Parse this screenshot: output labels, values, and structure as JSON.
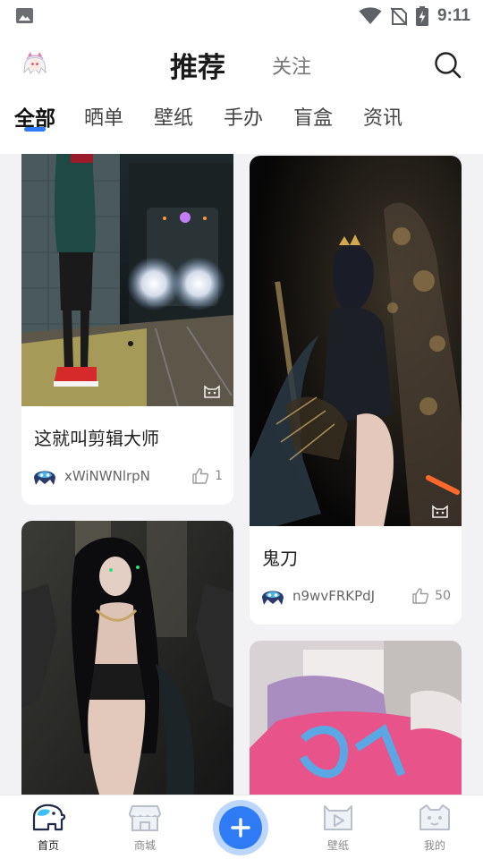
{
  "status_bar": {
    "time": "9:11",
    "icons": [
      "image-icon",
      "wifi-icon",
      "no-sim-icon",
      "battery-charging-icon"
    ]
  },
  "header": {
    "avatar_icon": "anime-girl-avatar",
    "tabs": [
      {
        "label": "推荐",
        "active": true
      },
      {
        "label": "关注",
        "active": false
      }
    ],
    "search_icon": "search-icon"
  },
  "categories": [
    {
      "label": "全部",
      "active": true
    },
    {
      "label": "晒单",
      "active": false
    },
    {
      "label": "壁纸",
      "active": false
    },
    {
      "label": "手办",
      "active": false
    },
    {
      "label": "盲盒",
      "active": false
    },
    {
      "label": "资讯",
      "active": false
    }
  ],
  "feed": {
    "cards": [
      {
        "title": "这就叫剪辑大师",
        "user": "xWiNWNlrpN",
        "likes": "1",
        "image": "subway-train-photo"
      },
      {
        "title": "鬼刀",
        "user": "n9wvFRKPdJ",
        "likes": "50",
        "image": "dark-fantasy-character-render"
      },
      {
        "title": "",
        "user": "",
        "likes": "",
        "image": "dark-warrior-woman-render"
      },
      {
        "title": "",
        "user": "",
        "likes": "",
        "image": "pink-figure-photo"
      }
    ]
  },
  "bottom_nav": {
    "items": [
      {
        "label": "首页",
        "icon": "elephant-home-icon",
        "active": true
      },
      {
        "label": "商城",
        "icon": "shop-icon",
        "active": false
      },
      {
        "label": "",
        "icon": "add-icon",
        "active": false
      },
      {
        "label": "壁纸",
        "icon": "wallpaper-icon",
        "active": false
      },
      {
        "label": "我的",
        "icon": "cat-profile-icon",
        "active": false
      }
    ]
  },
  "colors": {
    "accent": "#2f7bf6",
    "add_ring": "#bcd7fb",
    "background": "#f2f2f4"
  }
}
